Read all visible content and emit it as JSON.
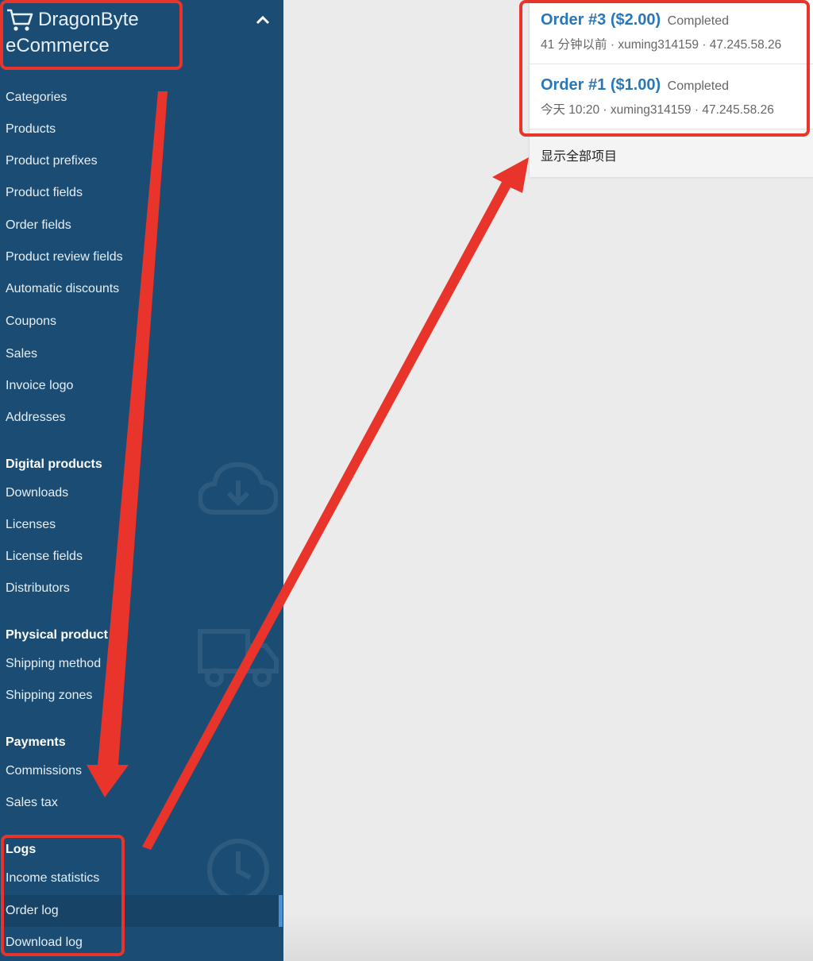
{
  "sidebar": {
    "brand_line1": "DragonByte",
    "brand_line2": "eCommerce",
    "items": [
      {
        "label": "Categories"
      },
      {
        "label": "Products"
      },
      {
        "label": "Product prefixes"
      },
      {
        "label": "Product fields"
      },
      {
        "label": "Order fields"
      },
      {
        "label": "Product review fields"
      },
      {
        "label": "Automatic discounts"
      },
      {
        "label": "Coupons"
      },
      {
        "label": "Sales"
      },
      {
        "label": "Invoice logo"
      },
      {
        "label": "Addresses"
      }
    ],
    "digital": {
      "title": "Digital products",
      "items": [
        {
          "label": "Downloads"
        },
        {
          "label": "Licenses"
        },
        {
          "label": "License fields"
        },
        {
          "label": "Distributors"
        }
      ]
    },
    "physical": {
      "title": "Physical product",
      "items": [
        {
          "label": "Shipping method"
        },
        {
          "label": "Shipping zones"
        }
      ]
    },
    "payments": {
      "title": "Payments",
      "items": [
        {
          "label": "Commissions"
        },
        {
          "label": "Sales tax"
        }
      ]
    },
    "logs": {
      "title": "Logs",
      "items": [
        {
          "label": "Income statistics"
        },
        {
          "label": "Order log"
        },
        {
          "label": "Download log"
        }
      ]
    }
  },
  "popup": {
    "orders": [
      {
        "title": "Order #3 ($2.00)",
        "status": "Completed",
        "meta": "41 分钟以前 · xuming314159 · 47.245.58.26"
      },
      {
        "title": "Order #1 ($1.00)",
        "status": "Completed",
        "meta": "今天 10:20 · xuming314159 · 47.245.58.26"
      }
    ],
    "show_all": "显示全部项目"
  },
  "colors": {
    "sidebar_bg": "#1b4d74",
    "link": "#2a77b8",
    "annotation": "#e8342a"
  }
}
